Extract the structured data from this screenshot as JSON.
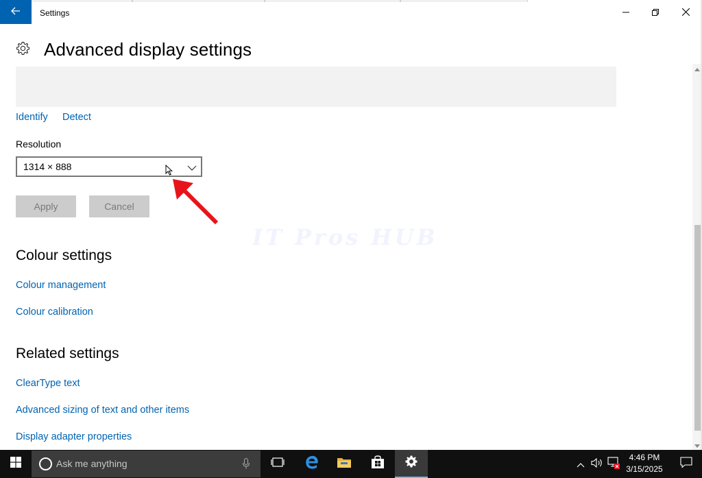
{
  "window": {
    "title": "Settings"
  },
  "page": {
    "title": "Advanced display settings",
    "header_icon": "gear-icon"
  },
  "display": {
    "identify_label": "Identify",
    "detect_label": "Detect",
    "resolution_label": "Resolution",
    "resolution_value": "1314 × 888",
    "apply_label": "Apply",
    "cancel_label": "Cancel"
  },
  "colour_settings": {
    "heading": "Colour settings",
    "links": [
      "Colour management",
      "Colour calibration"
    ]
  },
  "related_settings": {
    "heading": "Related settings",
    "links": [
      "ClearType text",
      "Advanced sizing of text and other items",
      "Display adapter properties"
    ]
  },
  "watermark": "IT Pros HUB",
  "taskbar": {
    "search_placeholder": "Ask me anything",
    "apps": [
      "task-view-icon",
      "edge-icon",
      "file-explorer-icon",
      "store-icon",
      "settings-icon"
    ],
    "active_app": "settings-icon",
    "tray_icons": [
      "chevron-up-icon",
      "volume-icon",
      "network-icon"
    ],
    "time": "4:46 PM",
    "date": "3/15/2025"
  },
  "colors": {
    "accent": "#0063b1",
    "link": "#0063b1",
    "taskbar": "#101010",
    "search_box": "#3c3c3c",
    "preview_area": "#f2f2f2",
    "disabled_button": "#cccccc",
    "annotation_arrow": "#e8141b"
  }
}
